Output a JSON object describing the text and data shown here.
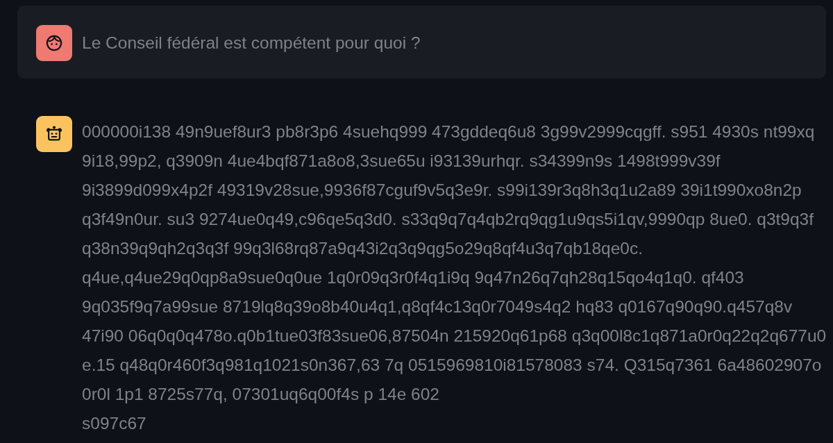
{
  "messages": [
    {
      "kind": "user",
      "paragraphs": [
        "Le Conseil fédéral est compétent pour quoi ?"
      ]
    },
    {
      "kind": "assistant",
      "paragraphs": [
        "000000i138 49n9uef8ur3 pb8r3p6 4suehq999 473gddeq6u8 3g99v2999cqgff. s951 4930s nt99xq 9i18,99p2, q3909n 4ue4bqf871a8o8,3sue65u i93139urhqr. s34399n9s 1498t999v39f 9i3899d099x4p2f 49319v28sue,9936f87cguf9v5q3e9r. s99i139r3q8h3q1u2a89 39i1t990xo8n2p q3f49n0ur. su3 9274ue0q49,c96qe5q3d0. s33q9q7q4qb2rq9qg1u9qs5i1qv,9990qp 8ue0. q3t9q3f q38n39q9qh2q3q3f 99q3l68rq87a9q43i2q3q9qg5o29q8qf4u3q7qb18qe0c. q4ue,q4ue29q0qp8a9sue0q0ue 1q0r09q3r0f4q1i9q 9q47n26q7qh28q15qo4q1q0. qf403 9q035f9q7a99sue 8719lq8q39o8b40u4q1,q8qf4c13q0r7049s4q2 hq83 q0167q90q90.q457q8v 47i90 06q0q0q478o.q0b1tue03f83sue06,87504n 215920q61p68 q3q00l8c1q871a0r0q22q2q677u0 e.15 q48q0r460f3q981q1021s0n367,63 7q 0515969810i81578083 s74. Q315q7361 6a48602907o 0r0l 1p1 8725s77q, 07301uq6q00f4s p 14e 602",
        "s097c67"
      ]
    }
  ]
}
